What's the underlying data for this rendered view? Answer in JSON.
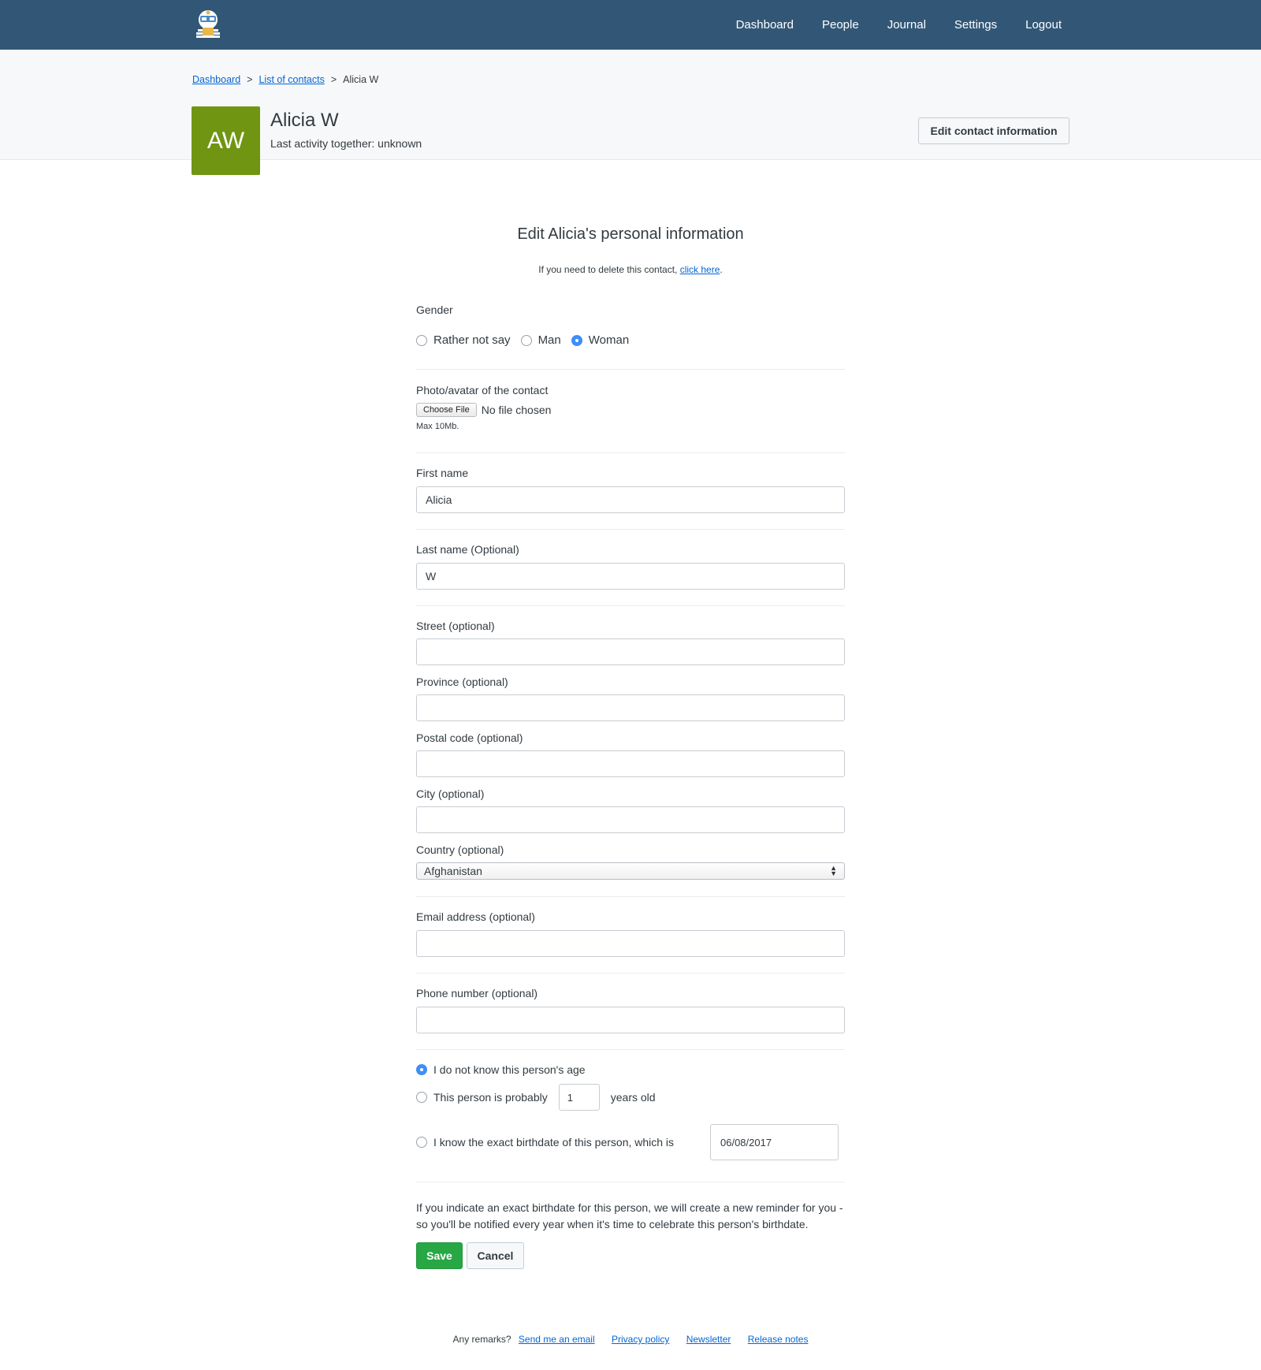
{
  "nav": {
    "logo_icon": "monica-logo-icon",
    "items": [
      "Dashboard",
      "People",
      "Journal",
      "Settings",
      "Logout"
    ]
  },
  "breadcrumb": {
    "items": [
      "Dashboard",
      "List of contacts",
      "Alicia W"
    ],
    "separator": ">"
  },
  "contact": {
    "initials": "AW",
    "avatar_color": "#709512",
    "name": "Alicia W",
    "last_activity": "Last activity together: unknown",
    "edit_button": "Edit contact information"
  },
  "form": {
    "title": "Edit Alicia's personal information",
    "delete_note_prefix": "If you need to delete this contact,",
    "delete_link": "click here",
    "delete_note_suffix": ".",
    "gender": {
      "label": "Gender",
      "options": [
        "Rather not say",
        "Man",
        "Woman"
      ],
      "selected": "Woman"
    },
    "photo": {
      "label": "Photo/avatar of the contact",
      "choose_file": "Choose File",
      "file_status": "No file chosen",
      "max_size": "Max 10Mb."
    },
    "first_name": {
      "label": "First name",
      "value": "Alicia"
    },
    "last_name": {
      "label": "Last name (Optional)",
      "value": "W"
    },
    "street": {
      "label": "Street (optional)",
      "value": ""
    },
    "province": {
      "label": "Province (optional)",
      "value": ""
    },
    "postal_code": {
      "label": "Postal code (optional)",
      "value": ""
    },
    "city": {
      "label": "City (optional)",
      "value": ""
    },
    "country": {
      "label": "Country (optional)",
      "value": "Afghanistan"
    },
    "email": {
      "label": "Email address (optional)",
      "value": ""
    },
    "phone": {
      "label": "Phone number (optional)",
      "value": ""
    },
    "age": {
      "option_unknown": "I do not know this person's age",
      "option_probably": "This person is probably",
      "probable_age": "1",
      "years_old": "years old",
      "option_exact": "I know the exact birthdate of this person, which is",
      "birthdate": "06/08/2017",
      "selected": "unknown"
    },
    "reminder_note": "If you indicate an exact birthdate for this person, we will create a new reminder for you - so you'll be notified every year when it's time to celebrate this person's birthdate.",
    "save": "Save",
    "cancel": "Cancel"
  },
  "footer": {
    "remarks": "Any remarks?",
    "links": [
      "Send me an email",
      "Privacy policy",
      "Newsletter",
      "Release notes"
    ]
  },
  "colors": {
    "navbar": "#325776",
    "save_button": "#28a745",
    "radio_selected": "#3e8ef7",
    "link": "#0366d6"
  }
}
